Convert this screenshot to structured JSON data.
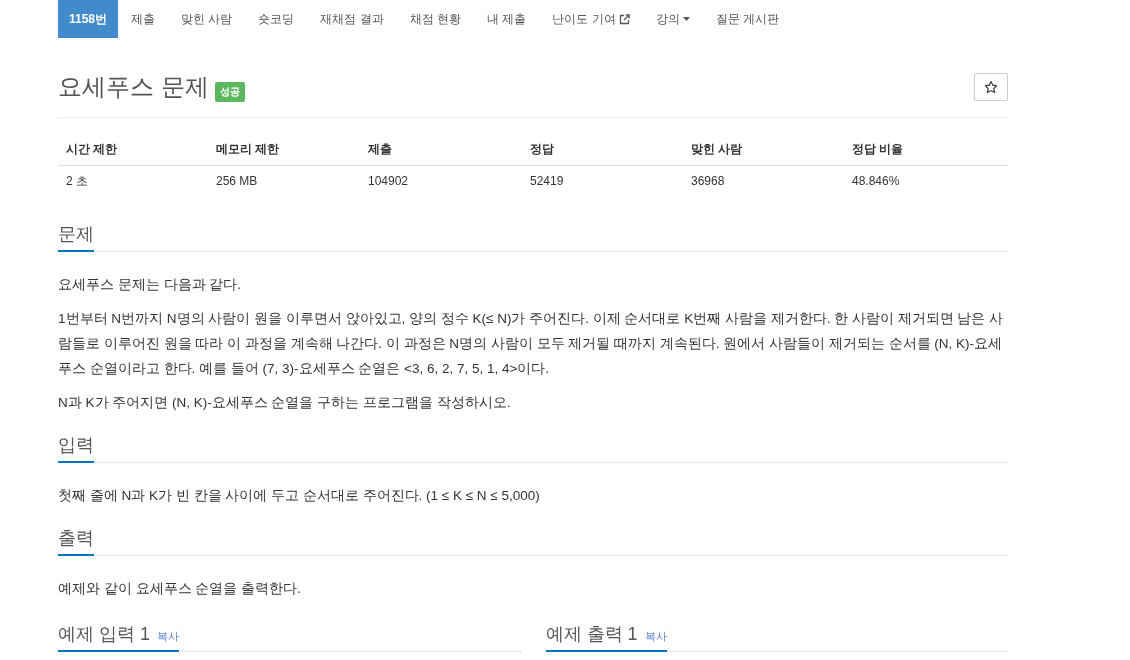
{
  "nav": [
    {
      "label": "1158번",
      "kind": "link",
      "selected": true
    },
    {
      "label": "제출",
      "kind": "link",
      "selected": false
    },
    {
      "label": "맞힌 사람",
      "kind": "link",
      "selected": false
    },
    {
      "label": "숏코딩",
      "kind": "link",
      "selected": false
    },
    {
      "label": "재채점 결과",
      "kind": "link",
      "selected": false
    },
    {
      "label": "채점 현황",
      "kind": "link",
      "selected": false
    },
    {
      "label": "내 제출",
      "kind": "link",
      "selected": false
    },
    {
      "label": "난이도 기여",
      "kind": "external",
      "selected": false
    },
    {
      "label": "강의",
      "kind": "dropdown",
      "selected": false
    },
    {
      "label": "질문 게시판",
      "kind": "link",
      "selected": false
    }
  ],
  "problem": {
    "title": "요세푸스 문제",
    "badge": "성공",
    "starred": false
  },
  "stats": {
    "columns": [
      "시간 제한",
      "메모리 제한",
      "제출",
      "정답",
      "맞힌 사람",
      "정답 비율"
    ],
    "rows": [
      [
        "2 초",
        "256 MB",
        "104902",
        "52419",
        "36968",
        "48.846%"
      ]
    ]
  },
  "sections": [
    {
      "heading": "문제",
      "paragraphs": [
        "요세푸스 문제는 다음과 같다.",
        "1번부터 N번까지 N명의 사람이 원을 이루면서 앉아있고, 양의 정수 K(≤ N)가 주어진다. 이제 순서대로 K번째 사람을 제거한다. 한 사람이 제거되면 남은 사람들로 이루어진 원을 따라 이 과정을 계속해 나간다. 이 과정은 N명의 사람이 모두 제거될 때까지 계속된다. 원에서 사람들이 제거되는 순서를 (N, K)-요세푸스 순열이라고 한다. 예를 들어 (7, 3)-요세푸스 순열은 <3, 6, 2, 7, 5, 1, 4>이다.",
        "N과 K가 주어지면 (N, K)-요세푸스 순열을 구하는 프로그램을 작성하시오."
      ]
    },
    {
      "heading": "입력",
      "paragraphs": [
        "첫째 줄에 N과 K가 빈 칸을 사이에 두고 순서대로 주어진다. (1 ≤ K ≤ N ≤ 5,000)"
      ]
    },
    {
      "heading": "출력",
      "paragraphs": [
        "예제와 같이 요세푸스 순열을 출력한다."
      ]
    }
  ],
  "samples": [
    {
      "heading": "예제 입력 1",
      "copy": "복사"
    },
    {
      "heading": "예제 출력 1",
      "copy": "복사"
    }
  ]
}
